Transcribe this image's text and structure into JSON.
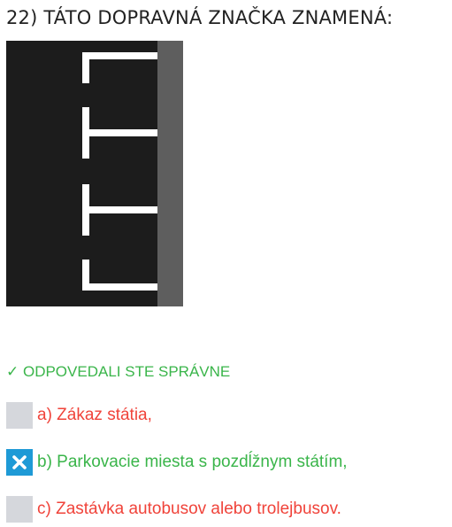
{
  "question": {
    "title": "22) TÁTO DOPRAVNÁ ZNAČKA ZNAMENÁ:"
  },
  "sign": {
    "icon": "parallel-parking-road-marking",
    "colors": {
      "road": "#1c1c1c",
      "curb": "#5e5e5e",
      "marking": "#ffffff"
    }
  },
  "result": {
    "status_text": "✓ ODPOVEDALI STE SPRÁVNE",
    "color": "#3ab54a"
  },
  "answers": [
    {
      "label": "a) Zákaz státia,",
      "selected": false,
      "correct": false,
      "color": "#f0433a"
    },
    {
      "label": "b) Parkovacie miesta s pozdĺžnym státím,",
      "selected": true,
      "correct": true,
      "color": "#3ab54a",
      "icon": "close-x-icon"
    },
    {
      "label": "c) Zastávka autobusov alebo trolejbusov.",
      "selected": false,
      "correct": false,
      "color": "#f0433a"
    }
  ],
  "colors": {
    "checkbox_default": "#d5d7dc",
    "checkbox_selected": "#1e9ad6"
  }
}
